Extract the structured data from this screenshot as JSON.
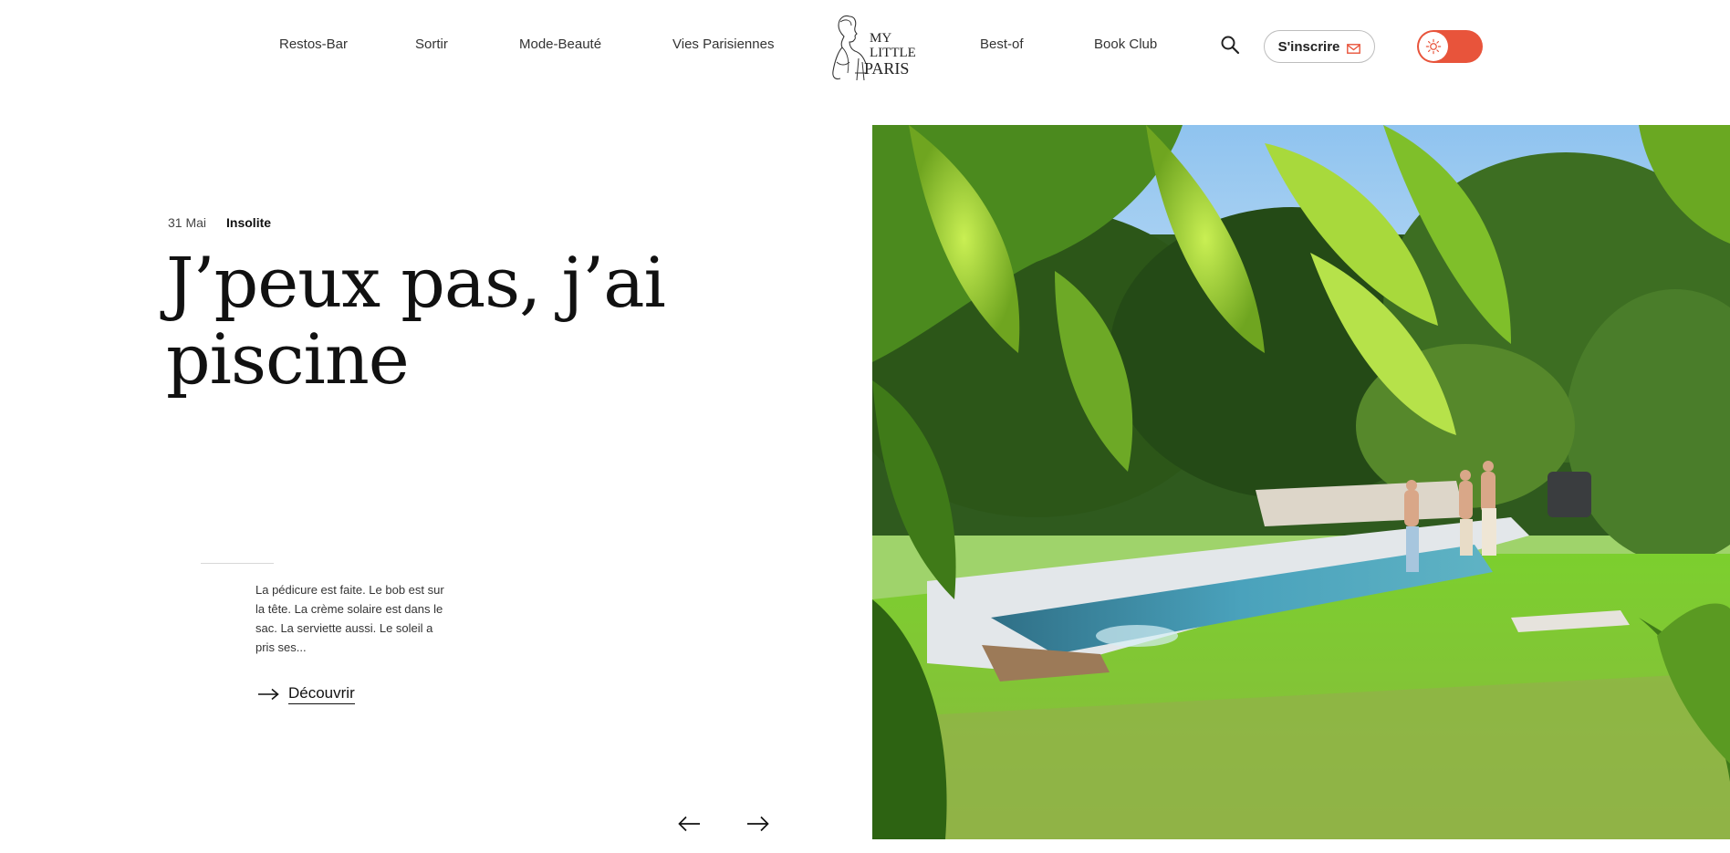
{
  "nav": {
    "left": [
      "Restos-Bar",
      "Sortir",
      "Mode-Beauté",
      "Vies Parisiennes"
    ],
    "right": [
      "Best-of",
      "Book Club"
    ]
  },
  "logo": {
    "text": "MY LITTLE PARIS",
    "line1": "MY",
    "line2": "LITTLE",
    "line3": "PARIS"
  },
  "signup": {
    "label": "S'inscrire"
  },
  "theme_toggle": {
    "mode": "light",
    "accent": "#e8543b"
  },
  "article": {
    "date": "31 Mai",
    "category": "Insolite",
    "title_line1": "J’peux pas, j’ai",
    "title_line2": "piscine",
    "excerpt": "La pédicure est faite.  Le bob est sur la tête. La crème solaire est dans le sac. La serviette aussi. Le soleil a pris ses...",
    "cta": "Découvrir"
  },
  "icons": {
    "search": "search-icon",
    "mail": "mail-icon",
    "sun": "sun-icon",
    "arrow_right": "arrow-right-icon",
    "arrow_left": "arrow-left-icon"
  },
  "colors": {
    "accent": "#e8543b",
    "text": "#111111"
  }
}
